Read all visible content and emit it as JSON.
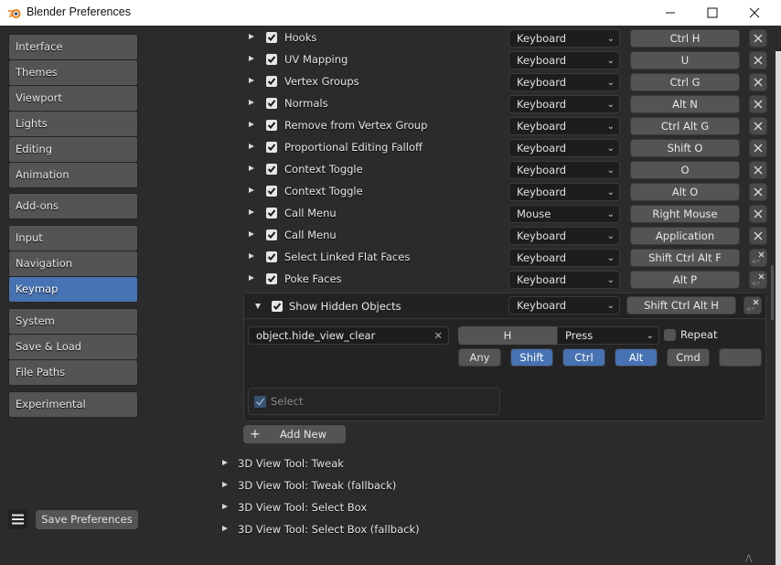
{
  "window": {
    "title": "Blender Preferences",
    "controls": {
      "minimize": "—",
      "maximize": "☐",
      "close": "✕"
    }
  },
  "sidebar": {
    "groups": [
      [
        "Interface",
        "Themes",
        "Viewport",
        "Lights",
        "Editing",
        "Animation"
      ],
      [
        "Add-ons"
      ],
      [
        "Input",
        "Navigation",
        "Keymap"
      ],
      [
        "System",
        "Save & Load",
        "File Paths"
      ],
      [
        "Experimental"
      ]
    ],
    "active": "Keymap",
    "save_label": "Save Preferences"
  },
  "keymap_items": [
    {
      "name": "Hooks",
      "type": "Keyboard",
      "key": "Ctrl H",
      "action": "remove"
    },
    {
      "name": "UV Mapping",
      "type": "Keyboard",
      "key": "U",
      "action": "remove"
    },
    {
      "name": "Vertex Groups",
      "type": "Keyboard",
      "key": "Ctrl G",
      "action": "remove"
    },
    {
      "name": "Normals",
      "type": "Keyboard",
      "key": "Alt N",
      "action": "remove"
    },
    {
      "name": "Remove from Vertex Group",
      "type": "Keyboard",
      "key": "Ctrl Alt G",
      "action": "remove"
    },
    {
      "name": "Proportional Editing Falloff",
      "type": "Keyboard",
      "key": "Shift O",
      "action": "remove"
    },
    {
      "name": "Context Toggle",
      "type": "Keyboard",
      "key": "O",
      "action": "remove"
    },
    {
      "name": "Context Toggle",
      "type": "Keyboard",
      "key": "Alt O",
      "action": "remove"
    },
    {
      "name": "Call Menu",
      "type": "Mouse",
      "key": "Right Mouse",
      "action": "remove"
    },
    {
      "name": "Call Menu",
      "type": "Keyboard",
      "key": "Application",
      "action": "remove"
    },
    {
      "name": "Select Linked Flat Faces",
      "type": "Keyboard",
      "key": "Shift Ctrl Alt F",
      "action": "restore"
    },
    {
      "name": "Poke Faces",
      "type": "Keyboard",
      "key": "Alt P",
      "action": "restore"
    }
  ],
  "expanded_item": {
    "name": "Show Hidden Objects",
    "type": "Keyboard",
    "key": "Shift Ctrl Alt H",
    "operator": "object.hide_view_clear",
    "event_key": "H",
    "event_value": "Press",
    "repeat_label": "Repeat",
    "modifiers": [
      {
        "label": "Any",
        "on": false
      },
      {
        "label": "Shift",
        "on": true
      },
      {
        "label": "Ctrl",
        "on": true
      },
      {
        "label": "Alt",
        "on": true
      },
      {
        "label": "Cmd",
        "on": false
      },
      {
        "label": "",
        "on": false
      }
    ],
    "property_label": "Select"
  },
  "add_new_label": "Add New",
  "groups": [
    "3D View Tool: Tweak",
    "3D View Tool: Tweak (fallback)",
    "3D View Tool: Select Box",
    "3D View Tool: Select Box (fallback)"
  ],
  "colors": {
    "accent": "#4772b3",
    "logo": "#e87d0d"
  }
}
